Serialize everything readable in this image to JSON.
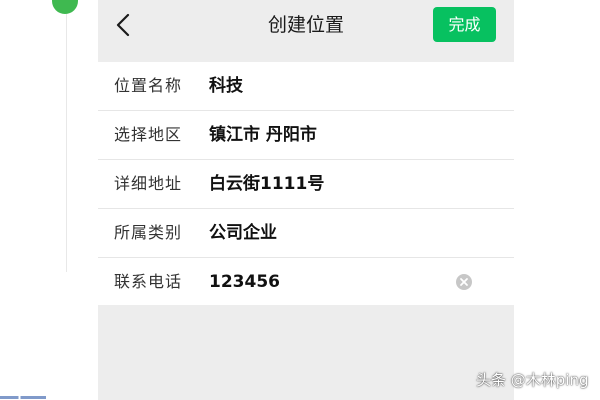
{
  "header": {
    "title": "创建位置",
    "back_icon": "chevron-left-icon",
    "done_label": "完成"
  },
  "form": {
    "rows": [
      {
        "label": "位置名称",
        "value": "科技"
      },
      {
        "label": "选择地区",
        "value": "镇江市 丹阳市"
      },
      {
        "label": "详细地址",
        "value": "白云街1111号"
      },
      {
        "label": "所属类别",
        "value": "公司企业"
      },
      {
        "label": "联系电话",
        "value": "123456",
        "clear_icon": "clear-x-icon"
      }
    ]
  },
  "watermark": "头条 @木林ping",
  "colors": {
    "accent": "#07c160",
    "page_background": "#ededed",
    "badge": "#3fb950"
  }
}
